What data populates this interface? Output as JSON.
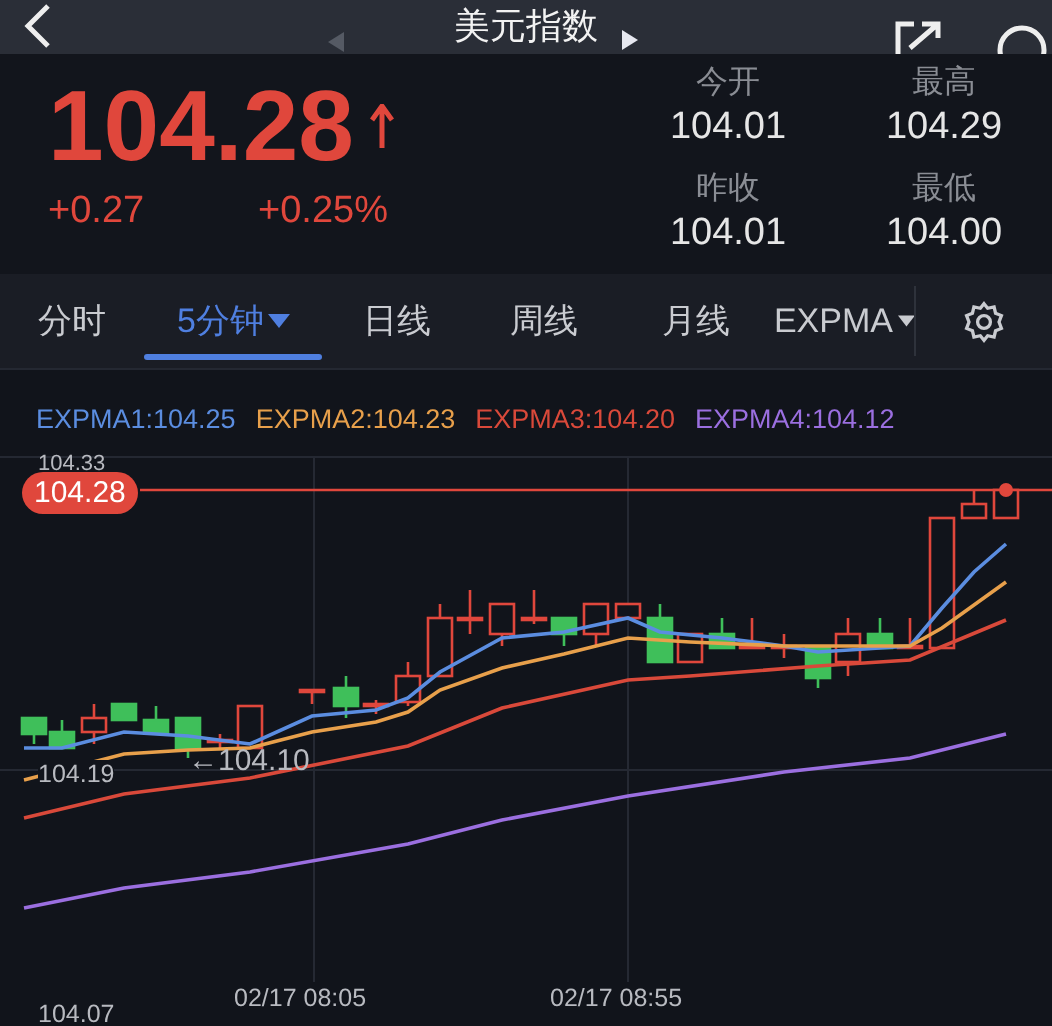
{
  "header": {
    "title": "美元指数"
  },
  "quote": {
    "price": "104.28",
    "rising": true,
    "change": "+0.27",
    "change_pct": "+0.25%"
  },
  "stats": [
    {
      "label": "今开",
      "value": "104.01"
    },
    {
      "label": "最高",
      "value": "104.29"
    },
    {
      "label": "昨收",
      "value": "104.01"
    },
    {
      "label": "最低",
      "value": "104.00"
    }
  ],
  "tabs": [
    {
      "label": "分时",
      "selected": false,
      "dropdown": false
    },
    {
      "label": "5分钟",
      "selected": true,
      "dropdown": true
    },
    {
      "label": "日线",
      "selected": false,
      "dropdown": false
    },
    {
      "label": "周线",
      "selected": false,
      "dropdown": false
    },
    {
      "label": "月线",
      "selected": false,
      "dropdown": false
    },
    {
      "label": "EXPMA",
      "selected": false,
      "dropdown": true
    }
  ],
  "legend": [
    {
      "label": "EXPMA1:104.25",
      "color": "#5b8de0"
    },
    {
      "label": "EXPMA2:104.23",
      "color": "#e8a04b"
    },
    {
      "label": "EXPMA3:104.20",
      "color": "#d9493a"
    },
    {
      "label": "EXPMA4:104.12",
      "color": "#9b6fe0"
    }
  ],
  "chart": {
    "top_label": "104.33",
    "current_price": "104.28",
    "mid_label": "104.19",
    "low_marker": "←104.10",
    "bottom_label": "104.07",
    "times": [
      "02/17 08:05",
      "02/17 08:55"
    ]
  }
}
